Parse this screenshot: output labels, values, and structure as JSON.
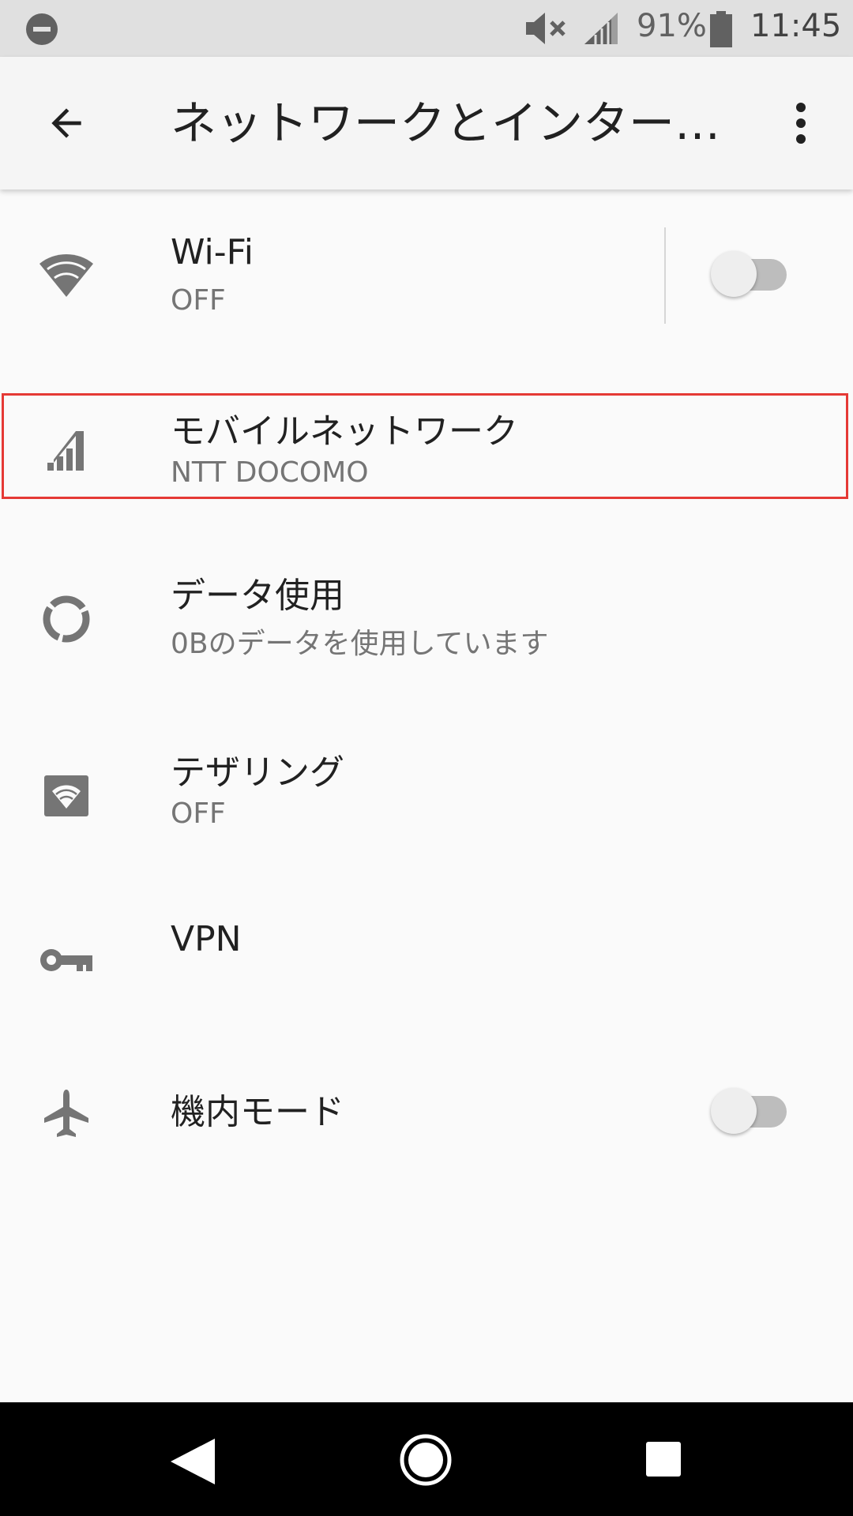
{
  "status_bar": {
    "battery_percent": "91%",
    "time": "11:45"
  },
  "app_bar": {
    "title": "ネットワークとインター…"
  },
  "items": [
    {
      "title": "Wi-Fi",
      "summary": "OFF",
      "icon": "wifi-icon",
      "has_switch": true,
      "switch_on": false
    },
    {
      "title": "モバイルネットワーク",
      "summary": "NTT DOCOMO",
      "icon": "signal-cellular-icon",
      "highlighted": true
    },
    {
      "title": "データ使用",
      "summary": "0Bのデータを使用しています",
      "icon": "data-usage-icon"
    },
    {
      "title": "テザリング",
      "summary": "OFF",
      "icon": "hotspot-icon"
    },
    {
      "title": "VPN",
      "summary": "",
      "icon": "vpn-key-icon"
    },
    {
      "title": "機内モード",
      "summary": "",
      "icon": "airplane-icon",
      "has_switch": true,
      "switch_on": false
    }
  ],
  "colors": {
    "highlight": "#e53935",
    "icon_gray": "#757575",
    "nav_bar": "#000000"
  }
}
